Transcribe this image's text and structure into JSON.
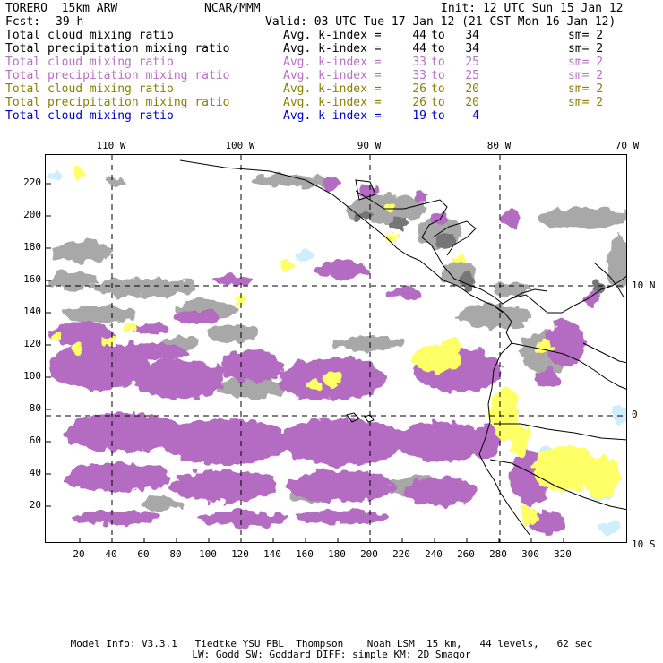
{
  "header": {
    "title_left": "TORERO  15km ARW",
    "center_org": "NCAR/MMM",
    "init": "Init: 12 UTC Sun 15 Jan 12",
    "fcst_label": "Fcst:",
    "fcst_value": "39 h",
    "valid": "Valid: 03 UTC Tue 17 Jan 12 (21 CST Mon 16 Jan 12)"
  },
  "fields": [
    {
      "label": "Total cloud mixing ratio",
      "avg": "Avg. k-index =",
      "from": "44",
      "to": "to",
      "end": "34",
      "sm": "sm= 2",
      "color": "#000000"
    },
    {
      "label": "Total precipitation mixing ratio",
      "avg": "Avg. k-index =",
      "from": "44",
      "to": "to",
      "end": "34",
      "sm": "sm= 2",
      "color": "#000000"
    },
    {
      "label": "Total cloud mixing ratio",
      "avg": "Avg. k-index =",
      "from": "33",
      "to": "to",
      "end": "25",
      "sm": "sm= 2",
      "color": "#b86fc4"
    },
    {
      "label": "Total precipitation mixing ratio",
      "avg": "Avg. k-index =",
      "from": "33",
      "to": "to",
      "end": "25",
      "sm": "sm= 2",
      "color": "#b86fc4"
    },
    {
      "label": "Total cloud mixing ratio",
      "avg": "Avg. k-index =",
      "from": "26",
      "to": "to",
      "end": "20",
      "sm": "sm= 2",
      "color": "#8c8000"
    },
    {
      "label": "Total precipitation mixing ratio",
      "avg": "Avg. k-index =",
      "from": "26",
      "to": "to",
      "end": "20",
      "sm": "sm= 2",
      "color": "#8c8000"
    },
    {
      "label": "Total cloud mixing ratio",
      "avg": "Avg. k-index =",
      "from": "19",
      "to": "to",
      "end": "4",
      "sm": "",
      "color": "#0000cc"
    }
  ],
  "map": {
    "lon_labels": [
      "110 W",
      "100 W",
      "90 W",
      "80 W",
      "70 W"
    ],
    "lat_labels": [
      "10 N",
      "0",
      "10 S"
    ],
    "x_ticks": [
      "20",
      "40",
      "60",
      "80",
      "100",
      "120",
      "140",
      "160",
      "180",
      "200",
      "220",
      "240",
      "260",
      "280",
      "300",
      "320"
    ],
    "y_ticks": [
      "220",
      "200",
      "180",
      "160",
      "140",
      "120",
      "100",
      "80",
      "60",
      "40",
      "20"
    ],
    "colors": {
      "high_cloud_gray": "#a0a0a0",
      "dark_gray": "#6e6e6e",
      "purple": "#b36cc2",
      "yellow": "#ffff66",
      "light_blue": "#cdeeff",
      "coast": "#000000"
    }
  },
  "footer": {
    "line1": "Model Info: V3.3.1   Tiedtke YSU PBL  Thompson    Noah LSM  15 km,   44 levels,   62 sec",
    "line2": "LW: Godd SW: Goddard DIFF: simple KM: 2D Smagor"
  }
}
